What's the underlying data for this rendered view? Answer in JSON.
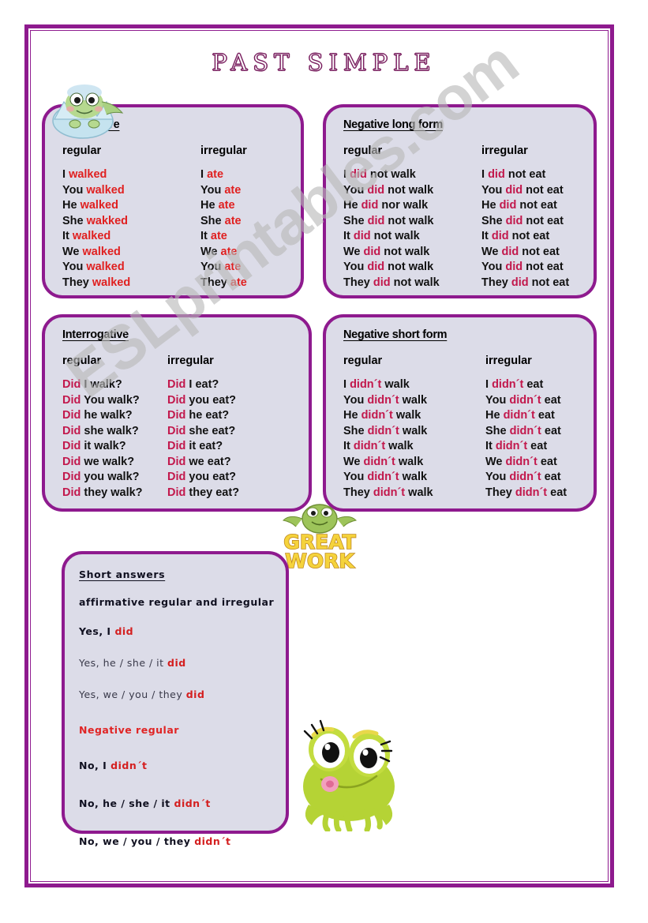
{
  "title": "PAST SIMPLE",
  "watermark": "ESLprintables.com",
  "colors": {
    "frame": "#8e1a8e",
    "box_border": "#8e1a8e",
    "box_fill": "#dcdce8",
    "accent_red": "#e02020",
    "accent_crimson": "#c2184c",
    "title_purple": "#7a2060"
  },
  "boxes": {
    "affirmative": {
      "title": "Affirmative",
      "heads": {
        "regular": "regular",
        "irregular": "irregular"
      },
      "regular": [
        {
          "subject": "I",
          "verb": "walked"
        },
        {
          "subject": "You",
          "verb": "walked"
        },
        {
          "subject": "He",
          "verb": "walked"
        },
        {
          "subject": "She",
          "verb": "wakked"
        },
        {
          "subject": "It",
          "verb": "walked"
        },
        {
          "subject": "We",
          "verb": "walked"
        },
        {
          "subject": "You",
          "verb": "walked"
        },
        {
          "subject": "They",
          "verb": "walked"
        }
      ],
      "irregular": [
        {
          "subject": "I",
          "verb": "ate"
        },
        {
          "subject": "You",
          "verb": "ate"
        },
        {
          "subject": "He",
          "verb": "ate"
        },
        {
          "subject": "She",
          "verb": "ate"
        },
        {
          "subject": "It",
          "verb": "ate"
        },
        {
          "subject": "We",
          "verb": "ate"
        },
        {
          "subject": "You",
          "verb": "ate"
        },
        {
          "subject": "They",
          "verb": "ate"
        }
      ]
    },
    "negative_long": {
      "title": "Negative long form",
      "heads": {
        "regular": "regular",
        "irregular": "irregular"
      },
      "regular": [
        {
          "subject": "I",
          "aux": "did",
          "rest": "not walk"
        },
        {
          "subject": "You",
          "aux": "did",
          "rest": "not walk"
        },
        {
          "subject": "He",
          "aux": "did",
          "rest": "nor walk"
        },
        {
          "subject": "She",
          "aux": "did",
          "rest": "not walk"
        },
        {
          "subject": "It",
          "aux": "did",
          "rest": "not walk"
        },
        {
          "subject": "We",
          "aux": "did",
          "rest": "not walk"
        },
        {
          "subject": "You",
          "aux": "did",
          "rest": "not walk"
        },
        {
          "subject": "They",
          "aux": "did",
          "rest": "not walk"
        }
      ],
      "irregular": [
        {
          "subject": "I",
          "aux": "did",
          "rest": "not eat"
        },
        {
          "subject": "You",
          "aux": "did",
          "rest": "not eat"
        },
        {
          "subject": "He",
          "aux": "did",
          "rest": "not eat"
        },
        {
          "subject": "She",
          "aux": "did",
          "rest": "not eat"
        },
        {
          "subject": "It",
          "aux": "did",
          "rest": "not eat"
        },
        {
          "subject": "We",
          "aux": "did",
          "rest": "not eat"
        },
        {
          "subject": "You",
          "aux": "did",
          "rest": "not eat"
        },
        {
          "subject": "They",
          "aux": "did",
          "rest": "not eat"
        }
      ]
    },
    "interrogative": {
      "title": "Interrogative",
      "heads": {
        "regular": "regular",
        "irregular": "irregular"
      },
      "regular": [
        {
          "aux": "Did",
          "rest": "I walk?"
        },
        {
          "aux": "Did",
          "rest": "You walk?"
        },
        {
          "aux": "Did",
          "rest": "he walk?"
        },
        {
          "aux": "Did",
          "rest": "she walk?"
        },
        {
          "aux": "Did",
          "rest": "it walk?"
        },
        {
          "aux": "Did",
          "rest": "we walk?"
        },
        {
          "aux": "Did",
          "rest": "you walk?"
        },
        {
          "aux": "Did",
          "rest": "they walk?"
        }
      ],
      "irregular": [
        {
          "aux": "Did",
          "rest": "I eat?"
        },
        {
          "aux": "Did",
          "rest": "you eat?"
        },
        {
          "aux": "Did",
          "rest": "he eat?"
        },
        {
          "aux": "Did",
          "rest": "she eat?"
        },
        {
          "aux": "Did",
          "rest": "it eat?"
        },
        {
          "aux": "Did",
          "rest": "we eat?"
        },
        {
          "aux": "Did",
          "rest": "you eat?"
        },
        {
          "aux": "Did",
          "rest": "they eat?"
        }
      ]
    },
    "negative_short": {
      "title": "Negative short form",
      "heads": {
        "regular": "regular",
        "irregular": "irregular"
      },
      "regular": [
        {
          "subject": "I",
          "aux": "didn´t",
          "rest": "walk"
        },
        {
          "subject": "You",
          "aux": "didn´t",
          "rest": "walk"
        },
        {
          "subject": "He",
          "aux": "didn´t",
          "rest": "walk"
        },
        {
          "subject": "She",
          "aux": "didn´t",
          "rest": "walk"
        },
        {
          "subject": "It",
          "aux": "didn´t",
          "rest": "walk"
        },
        {
          "subject": "We",
          "aux": "didn´t",
          "rest": "walk"
        },
        {
          "subject": "You",
          "aux": "didn´t",
          "rest": "walk"
        },
        {
          "subject": "They",
          "aux": "didn´t",
          "rest": "walk"
        }
      ],
      "irregular": [
        {
          "subject": "I",
          "aux": "didn´t",
          "rest": "eat"
        },
        {
          "subject": "You",
          "aux": "didn´t",
          "rest": "eat"
        },
        {
          "subject": "He",
          "aux": "didn´t",
          "rest": "eat"
        },
        {
          "subject": "She",
          "aux": "didn´t",
          "rest": "eat"
        },
        {
          "subject": "It",
          "aux": "didn´t",
          "rest": "eat"
        },
        {
          "subject": "We",
          "aux": "didn´t",
          "rest": "eat"
        },
        {
          "subject": "You",
          "aux": "didn´t",
          "rest": "eat"
        },
        {
          "subject": "They",
          "aux": "didn´t",
          "rest": "eat"
        }
      ]
    },
    "short_answers": {
      "title": "Short answers",
      "subheading": "affirmative regular  and  irregular",
      "affirmative": [
        {
          "text": "Yes, I ",
          "accent": "did",
          "style": "bold"
        },
        {
          "text": "Yes, he / she / it ",
          "accent": "did",
          "style": "light"
        },
        {
          "text": "Yes, we / you / they ",
          "accent": "did",
          "style": "light"
        }
      ],
      "negative_heading": "Negative regular",
      "negative": [
        {
          "text": "No, I ",
          "accent": "didn´t",
          "style": "bold"
        },
        {
          "text": "No, he / she / it ",
          "accent": "didn´t",
          "style": "bold"
        },
        {
          "text": "No,  we /  you / they ",
          "accent": "didn´t",
          "style": "bold"
        }
      ]
    }
  },
  "clipart": {
    "egg_frog": "frog-in-egg-icon",
    "great_work": "GREAT WORK",
    "great_work_line1": "GREAT",
    "great_work_line2": "WORK",
    "big_frog": "green-frog-icon"
  }
}
